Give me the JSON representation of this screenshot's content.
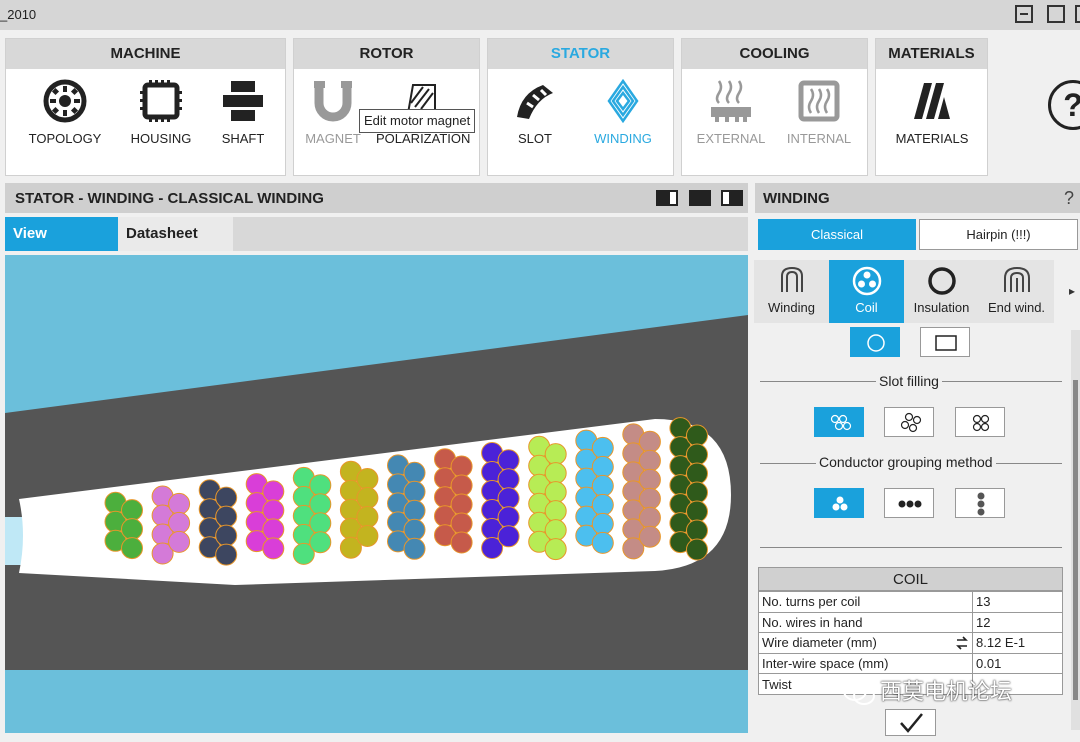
{
  "window": {
    "title": "_2010"
  },
  "ribbon": {
    "groups": [
      {
        "title": "MACHINE",
        "tools": [
          "TOPOLOGY",
          "HOUSING",
          "SHAFT"
        ]
      },
      {
        "title": "ROTOR",
        "tools": [
          "MAGNET",
          "POLARIZATION"
        ]
      },
      {
        "title": "STATOR",
        "tools": [
          "SLOT",
          "WINDING"
        ]
      },
      {
        "title": "COOLING",
        "tools": [
          "EXTERNAL",
          "INTERNAL"
        ]
      },
      {
        "title": "MATERIALS",
        "tools": [
          "MATERIALS"
        ]
      }
    ],
    "active_group": "STATOR",
    "active_tool": "WINDING",
    "help": "?",
    "tooltip": "Edit motor magnet"
  },
  "left_panel": {
    "title": "STATOR - WINDING - CLASSICAL WINDING",
    "tabs": [
      "View",
      "Datasheet"
    ],
    "active_tab": "View"
  },
  "right_panel": {
    "title": "WINDING",
    "help": "?",
    "type_buttons": [
      "Classical",
      "Hairpin (!!!)"
    ],
    "active_type": "Classical",
    "subtabs": [
      "Winding",
      "Coil",
      "Insulation",
      "End wind."
    ],
    "active_subtab": "Coil",
    "more_arrow": "▸",
    "slot_filling_label": "Slot filling",
    "grouping_label": "Conductor grouping method",
    "coil": {
      "title": "COIL",
      "rows": [
        {
          "label": "No. turns per coil",
          "value": "13"
        },
        {
          "label": "No. wires in hand",
          "value": "12"
        },
        {
          "label": "Wire diameter (mm)",
          "value": "8.12 E-1"
        },
        {
          "label": "Inter-wire space (mm)",
          "value": "0.01"
        },
        {
          "label": "Twist",
          "value": ""
        }
      ]
    },
    "ok_symbol": "✓"
  },
  "watermark": "西莫电机论坛",
  "colors": {
    "accent": "#1aa1dc",
    "background_blue": "#6bbfdb",
    "stator_iron": "#555555",
    "wire_border": "#e8962a"
  },
  "conductor_groups": [
    {
      "color": "#4caf3d"
    },
    {
      "color": "#d47ad8"
    },
    {
      "color": "#3d4660"
    },
    {
      "color": "#d93ed8"
    },
    {
      "color": "#4fe07e"
    },
    {
      "color": "#c3b41f"
    },
    {
      "color": "#4488b3"
    },
    {
      "color": "#c65a4a"
    },
    {
      "color": "#4b22d8"
    },
    {
      "color": "#b7ec55"
    },
    {
      "color": "#4cbfef"
    },
    {
      "color": "#c48c86"
    },
    {
      "color": "#2f5a1b"
    }
  ]
}
